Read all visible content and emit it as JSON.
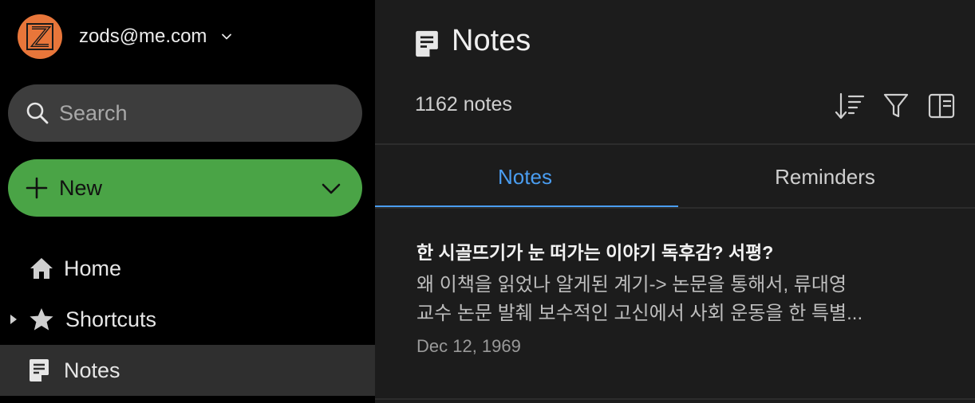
{
  "account": {
    "email": "zods@me.com",
    "avatar_letter": "Z",
    "avatar_color": "#e8763a"
  },
  "search": {
    "placeholder": "Search"
  },
  "new_button": {
    "label": "New",
    "color": "#4aa446"
  },
  "nav": {
    "items": [
      {
        "label": "Home",
        "icon": "home-icon"
      },
      {
        "label": "Shortcuts",
        "icon": "star-icon"
      },
      {
        "label": "Notes",
        "icon": "note-icon",
        "active": true
      }
    ]
  },
  "main": {
    "title": "Notes",
    "count": "1162 notes",
    "tabs": [
      {
        "label": "Notes",
        "active": true
      },
      {
        "label": "Reminders"
      }
    ],
    "accent": "#4a9df0"
  },
  "notes": [
    {
      "title": "한 시골뜨기가 눈 떠가는 이야기 독후감? 서평?",
      "snippet_line1": "왜 이책을 읽었나 알게된 계기-> 논문을 통해서, 류대영",
      "snippet_line2": "교수 논문 발췌 보수적인 고신에서 사회 운동을 한 특별...",
      "date": "Dec 12, 1969"
    }
  ]
}
